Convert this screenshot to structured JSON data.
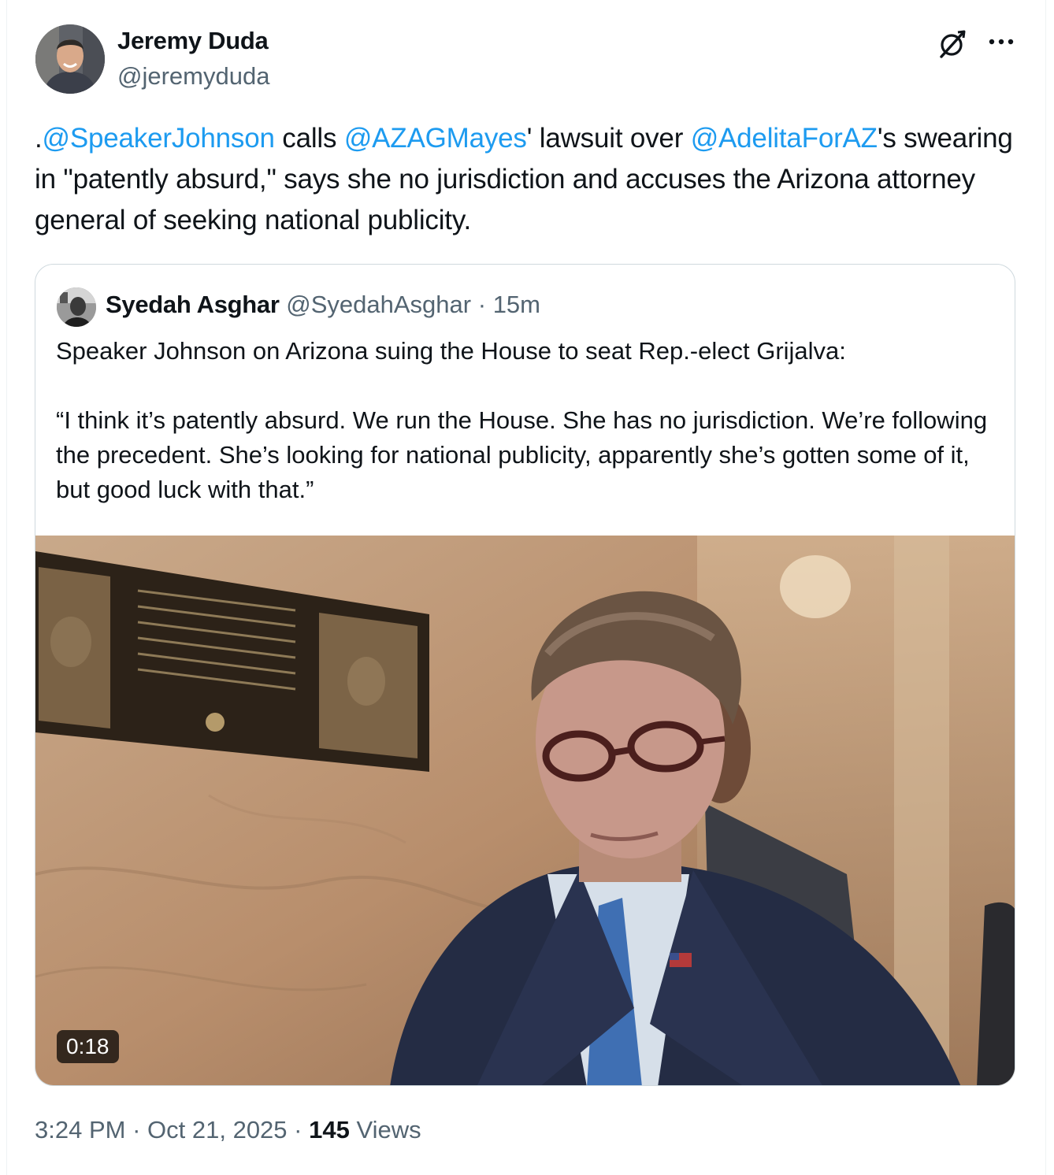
{
  "author": {
    "name": "Jeremy Duda",
    "handle": "@jeremyduda"
  },
  "tweet": {
    "prefix": ".",
    "mention1": "@SpeakerJohnson",
    "text1": " calls ",
    "mention2": "@AZAGMayes",
    "text2": "' lawsuit over ",
    "mention3": "@AdelitaForAZ",
    "text3": "'s swearing in \"patently absurd,\" says she no jurisdiction and accuses the Arizona attorney general of seeking national publicity."
  },
  "quote": {
    "name": "Syedah Asghar",
    "handle": "@SyedahAsghar",
    "separator": "·",
    "time": "15m",
    "text": "Speaker Johnson on Arizona suing the House to seat Rep.-elect Grijalva:\n\n“I think it’s patently absurd. We run the House. She has no jurisdiction. We’re following the precedent. She’s looking for national publicity, apparently she’s gotten some of it, but good luck with that.”",
    "video_duration": "0:18"
  },
  "meta": {
    "time": "3:24 PM",
    "dot1": "·",
    "date": "Oct 21, 2025",
    "dot2": "·",
    "views_count": "145",
    "views_label": "Views"
  },
  "icons": {
    "grok": "grok-icon",
    "more": "more-icon"
  },
  "colors": {
    "link": "#1d9bf0",
    "secondary_text": "#536471",
    "primary_text": "#0f1419",
    "border": "#cfd9de"
  }
}
